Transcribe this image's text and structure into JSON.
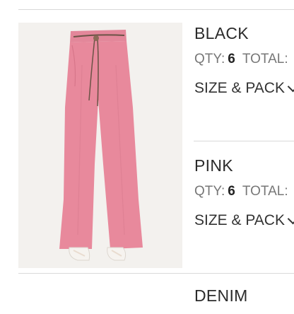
{
  "variants": [
    {
      "color": "BLACK",
      "qty_label": "QTY:",
      "qty_value": "6",
      "total_label": "TOTAL:",
      "size_pack_label": "SIZE & PACK"
    },
    {
      "color": "PINK",
      "qty_label": "QTY:",
      "qty_value": "6",
      "total_label": "TOTAL:",
      "size_pack_label": "SIZE & PACK"
    },
    {
      "color": "DENIM"
    }
  ],
  "icons": {
    "size_pack": "chevron-down-icon"
  },
  "colors": {
    "product_pink": "#e8899c",
    "background_image": "#f3f1ee",
    "divider": "#d9d9d9"
  }
}
